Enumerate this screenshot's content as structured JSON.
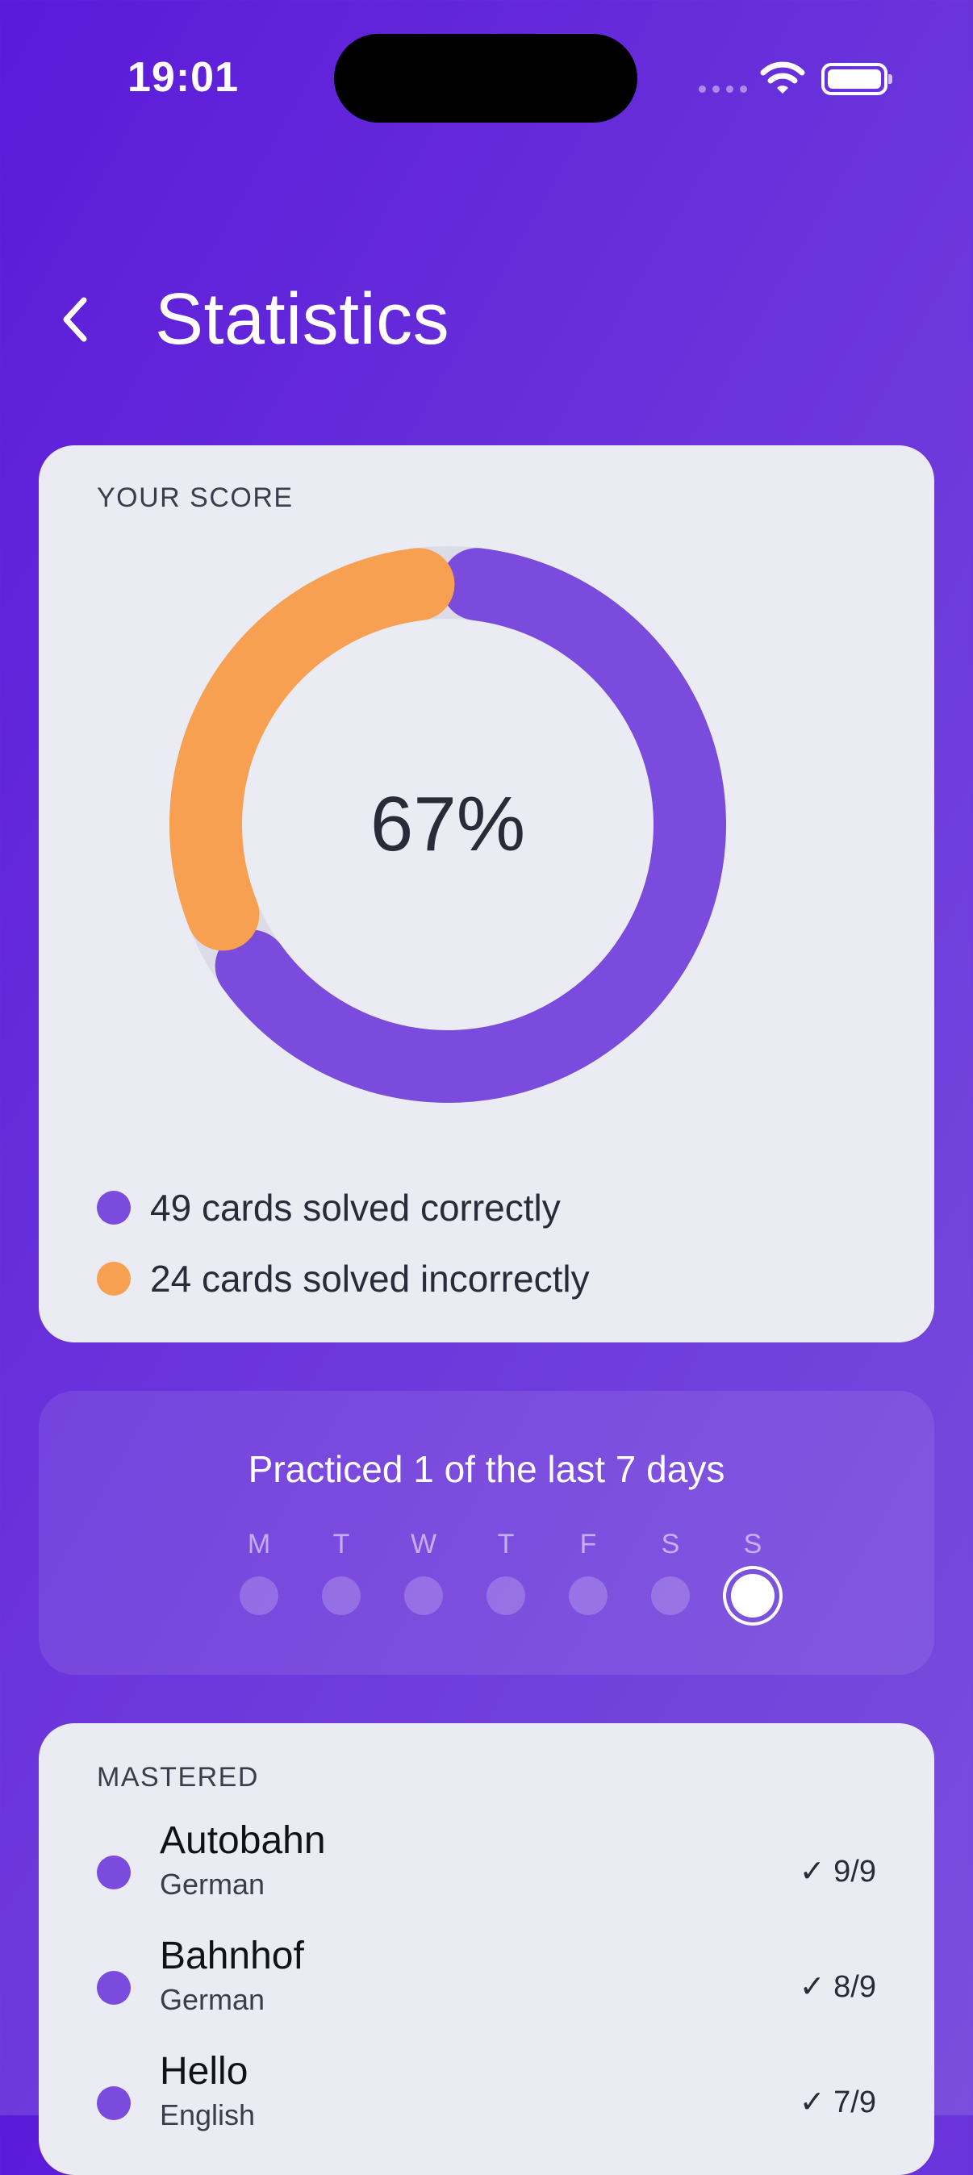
{
  "status_bar": {
    "time": "19:01"
  },
  "header": {
    "title": "Statistics",
    "back_icon": "chevron-left-icon"
  },
  "score_card": {
    "label": "YOUR SCORE",
    "percent_text": "67%",
    "correct_fraction": 0.67,
    "legend": [
      {
        "text": "49 cards solved correctly",
        "color": "#7a4bdc"
      },
      {
        "text": "24 cards solved incorrectly",
        "color": "#f8a052"
      }
    ]
  },
  "practice": {
    "title": "Practiced 1 of the last 7 days",
    "days": [
      {
        "label": "M",
        "practiced": false
      },
      {
        "label": "T",
        "practiced": false
      },
      {
        "label": "W",
        "practiced": false
      },
      {
        "label": "T",
        "practiced": false
      },
      {
        "label": "F",
        "practiced": false
      },
      {
        "label": "S",
        "practiced": false
      },
      {
        "label": "S",
        "practiced": true
      }
    ]
  },
  "mastered": {
    "label": "MASTERED",
    "items": [
      {
        "word": "Autobahn",
        "language": "German",
        "score": "✓ 9/9"
      },
      {
        "word": "Bahnhof",
        "language": "German",
        "score": "✓ 8/9"
      },
      {
        "word": "Hello",
        "language": "English",
        "score": "✓ 7/9"
      }
    ]
  },
  "colors": {
    "accent_purple": "#7a4bdc",
    "accent_orange": "#f8a052",
    "card_background": "#ebebf3"
  }
}
